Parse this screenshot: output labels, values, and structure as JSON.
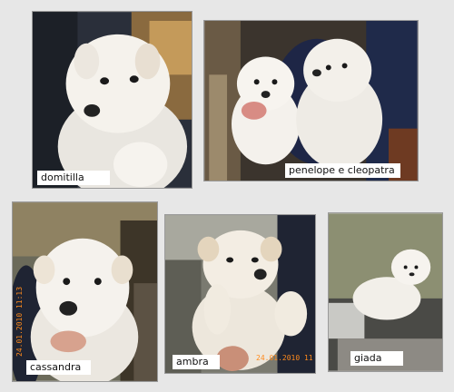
{
  "photos": [
    {
      "caption": "domitilla"
    },
    {
      "caption": "penelope e cleopatra"
    },
    {
      "caption": "cassandra",
      "date_stamp": "24.01.2010 11:13"
    },
    {
      "caption": "ambra",
      "date_stamp": "24.01.2010 11"
    },
    {
      "caption": "giada"
    }
  ],
  "colors": {
    "background": "#e7e7e7",
    "caption_bg": "#ffffff",
    "date_stamp": "#ff8a1c",
    "puppy_fur": "#f3f0ea"
  }
}
